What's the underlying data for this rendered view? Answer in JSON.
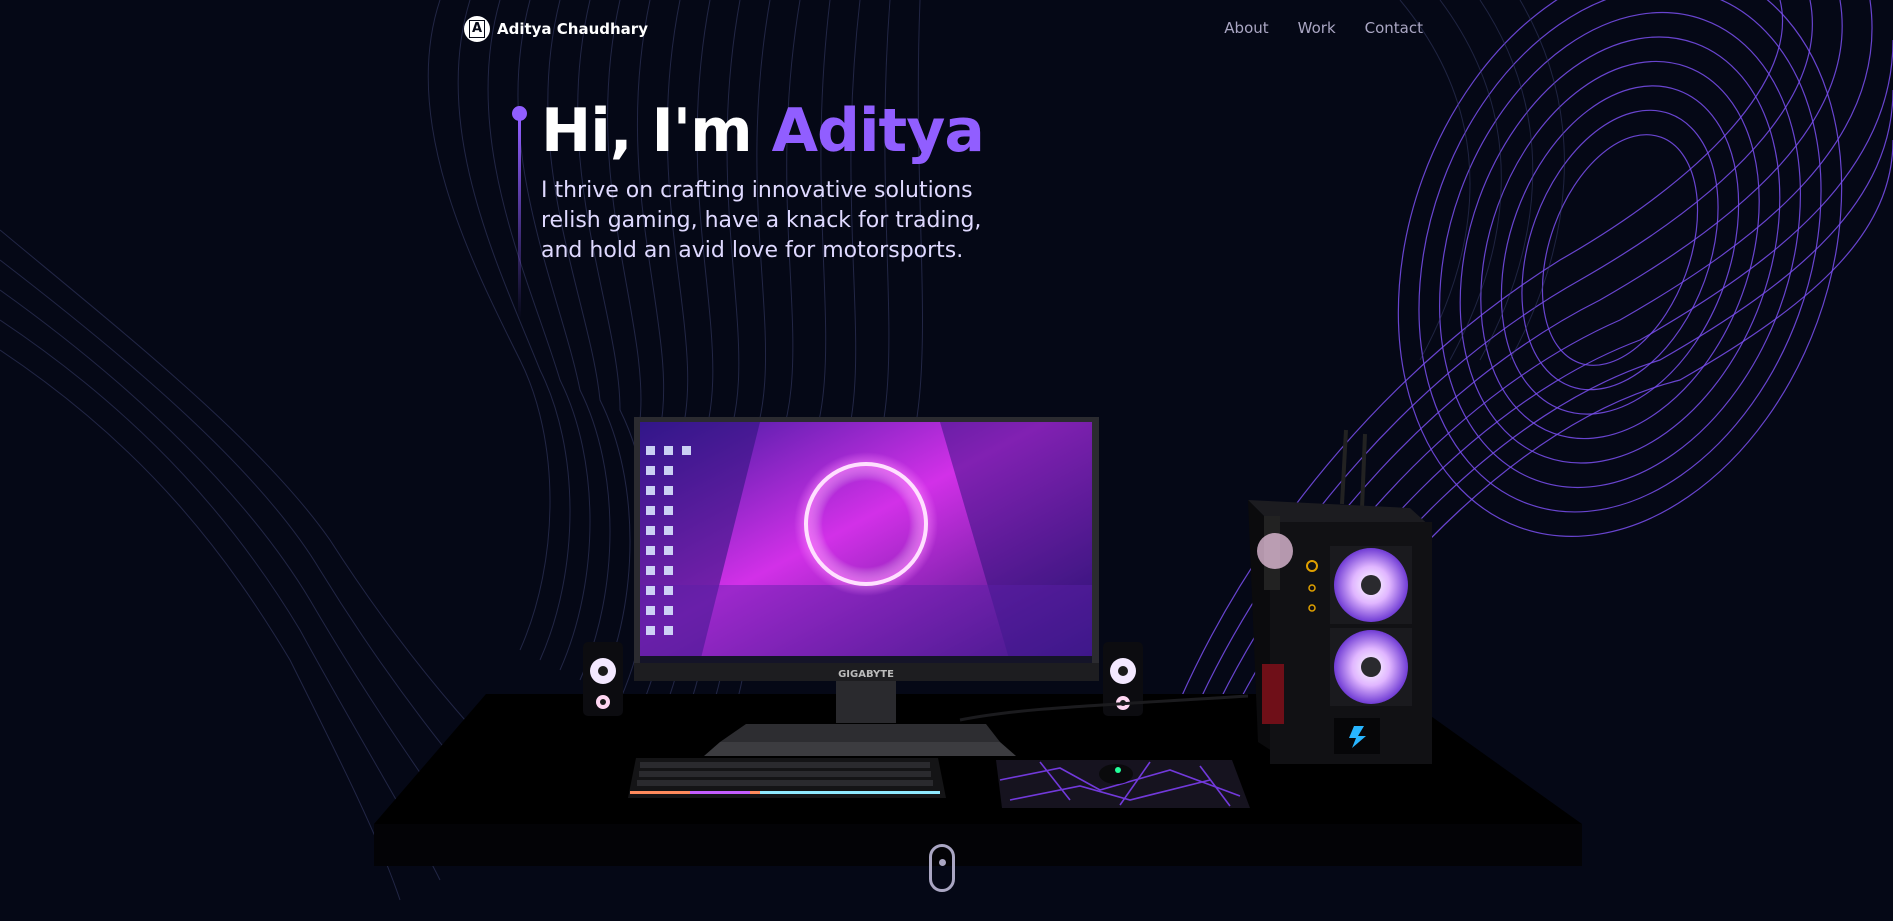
{
  "nav": {
    "logo_letter": "A",
    "brand": "Aditya Chaudhary",
    "links": [
      {
        "label": "About"
      },
      {
        "label": "Work"
      },
      {
        "label": "Contact"
      }
    ]
  },
  "hero": {
    "greeting": "Hi, I'm ",
    "name": "Aditya",
    "subtitle_lines": [
      "I thrive on crafting innovative solutions",
      "relish gaming, have a knack for trading,",
      "and hold an avid love for motorsports."
    ]
  },
  "scene": {
    "monitor_brand": "GIGABYTE"
  },
  "colors": {
    "background": "#050816",
    "accent": "#915eff",
    "nav_text": "#aaa6c3",
    "subtitle_text": "#dfd9ff"
  },
  "icons": [
    "logo-icon",
    "mouse-scroll-icon"
  ]
}
